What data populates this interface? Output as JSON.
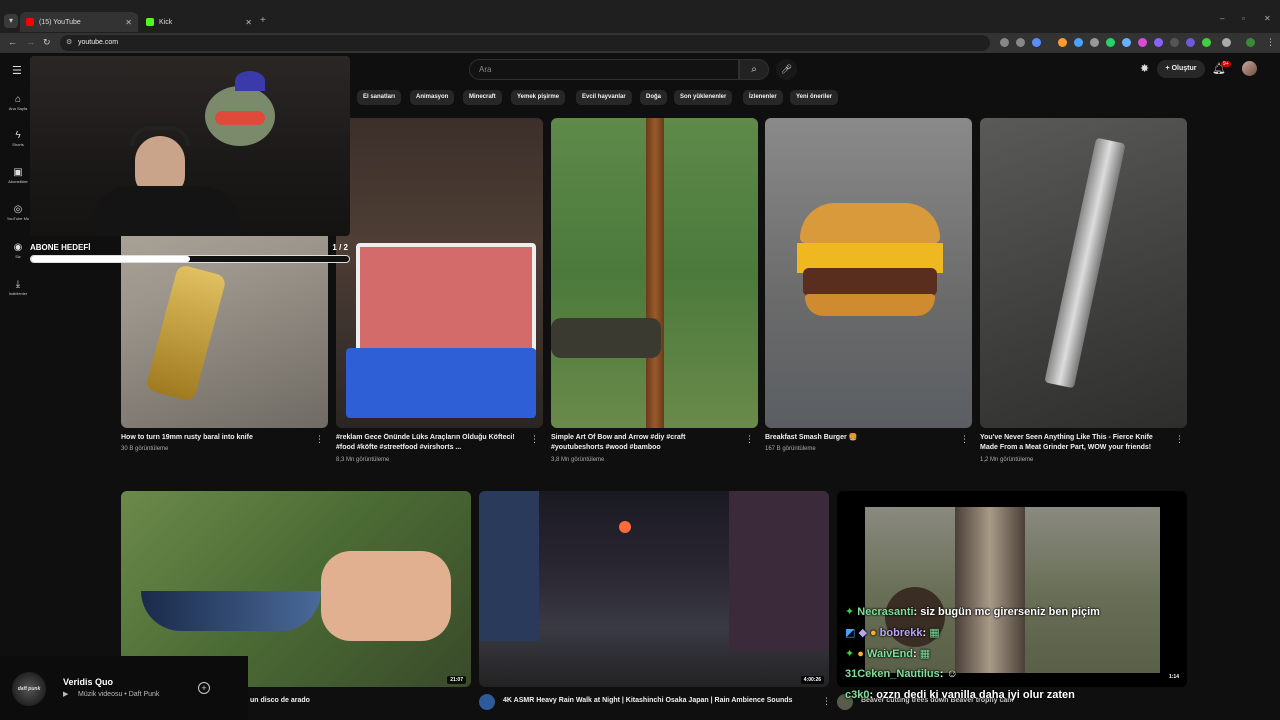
{
  "browser": {
    "tabs": [
      {
        "title": "(15) YouTube",
        "color": "#ff0000"
      },
      {
        "title": "Kick",
        "color": "#53fc18"
      }
    ],
    "url": "youtube.com"
  },
  "youtube": {
    "search_placeholder": "Ara",
    "create_label": "Oluştur",
    "notification_count": "9+",
    "sidebar": [
      {
        "label": "Ana Sayfa",
        "icon": "home-icon"
      },
      {
        "label": "Shorts",
        "icon": "shorts-icon"
      },
      {
        "label": "Abonelikler",
        "icon": "subscriptions-icon"
      },
      {
        "label": "YouTube Mu",
        "icon": "youtube-music-icon"
      },
      {
        "label": "Siz",
        "icon": "you-icon"
      },
      {
        "label": "İndirilenler",
        "icon": "downloads-icon"
      }
    ],
    "chips": [
      "El sanatları",
      "Animasyon",
      "Minecraft",
      "Yemek pişirme",
      "Evcil hayvanlar",
      "Doğa",
      "Son yüklenenler",
      "İzlenenler",
      "Yeni öneriler"
    ],
    "shorts": [
      {
        "title": "How to turn 19mm rusty baral into knife",
        "views": "30 B görüntüleme"
      },
      {
        "title": "#reklam Gece Önünde Lüks Araçların Olduğu Köfteci! #food #köfte #streetfood #virshorts ...",
        "views": "8,3 Mn görüntüleme"
      },
      {
        "title": "Simple Art Of  Bow and Arrow #diy #craft #youtubeshorts #wood #bamboo",
        "views": "3,8 Mn görüntüleme"
      },
      {
        "title": "Breakfast Smash Burger 🍔",
        "views": "167 B görüntüleme"
      },
      {
        "title": "You've Never Seen Anything Like This - Fierce Knife Made From a Meat Grinder Part, WOW your friends!",
        "views": "1,2 Mn görüntüleme"
      }
    ],
    "videos": [
      {
        "title": "un disco de arado",
        "duration": "21:07"
      },
      {
        "title": "4K ASMR Heavy Rain Walk at Night | Kitashinchi Osaka Japan | Rain Ambience Sounds",
        "duration": "4:00:26"
      },
      {
        "title": "Beaver cutting trees down Beaver trophy cam",
        "duration": "1:14"
      }
    ]
  },
  "stream_overlay": {
    "goal_label": "ABONE HEDEFİ",
    "goal_count": "1 / 2",
    "goal_progress": 0.5,
    "chat": [
      {
        "user": "Necrasanti",
        "message": ": siz bugün mc girerseniz ben piçim",
        "color": "#7fe09a"
      },
      {
        "user": "bobrekk",
        "message": ":",
        "color": "#b9a4ff"
      },
      {
        "user": "WaivEnd",
        "message": ":",
        "color": "#7fe09a"
      },
      {
        "user": "31Ceken_Nautilus",
        "message": ":",
        "color": "#7fe09a"
      },
      {
        "user": "c3k0",
        "message": ": ozzn dedi ki vanilla daha iyi olur zaten",
        "color": "#7fe09a"
      }
    ]
  },
  "now_playing": {
    "title": "Veridis Quo",
    "subtitle": "Müzik videosu • Daft Punk",
    "art_text": "daft punk"
  }
}
